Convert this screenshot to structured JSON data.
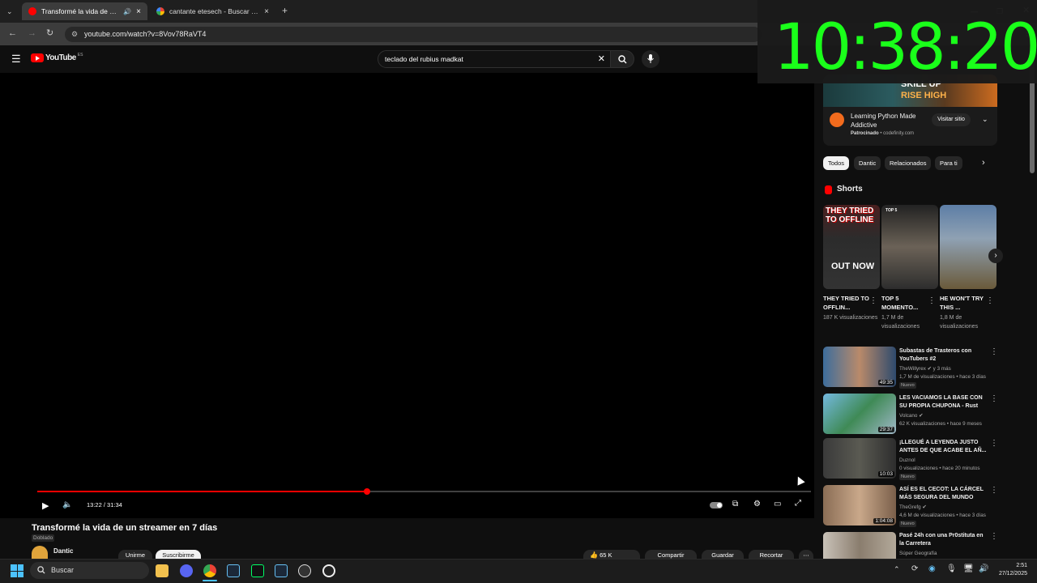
{
  "browser": {
    "tabs": [
      {
        "title": "Transformé la vida de un st",
        "active": true
      },
      {
        "title": "cantante etesech - Buscar con G",
        "active": false
      }
    ],
    "url": "youtube.com/watch?v=8Vov78RaVT4"
  },
  "youtube": {
    "logo": "YouTube",
    "region": "ES",
    "search_value": "teclado del rubius madkat",
    "player": {
      "time": "13:22 / 31:34",
      "progress_fraction": 0.426
    },
    "video": {
      "title": "Transformé la vida de un streamer en 7 días",
      "dub_label": "Doblado",
      "channel": "Dantic",
      "join_label": "Unirme",
      "subscribe_label": "Suscribirme",
      "likes": "65 K",
      "share_label": "Compartir",
      "save_label": "Guardar",
      "clip_label": "Recortar"
    },
    "ad": {
      "headline1": "SKILL UP",
      "headline2": "RISE HIGH",
      "title": "Learning Python Made Addictive",
      "sponsored": "Patrocinado",
      "domain": "codefinity.com",
      "cta": "Visitar sitio"
    },
    "chips": [
      "Todos",
      "Dantic",
      "Relacionados",
      "Para ti"
    ],
    "shorts_heading": "Shorts",
    "shorts": [
      {
        "title": "THEY TRIED TO OFFLIN...",
        "views": "187 K visualizaciones",
        "thumb_text1": "THEY TRIED",
        "thumb_text2": "TO OFFLINE",
        "thumb_text3": "OUT NOW"
      },
      {
        "title": "TOP 5 MOMENTO...",
        "views": "1,7 M de visualizaciones",
        "thumb_text1": "TOP 5"
      },
      {
        "title": "HE WON'T TRY THIS ...",
        "views": "1,8 M de visualizaciones"
      }
    ],
    "videos": [
      {
        "title": "Subastas de Trasteros con YouTubers #2",
        "channel": "TheWillyrex",
        "channel_extra": "y 3 más",
        "meta": "1,7 M de visualizaciones • hace 3 días",
        "duration": "49:35",
        "badge": "Nuevo"
      },
      {
        "title": "LES VACIAMOS LA BASE CON SU PROPIA CHUPONA - Rust",
        "channel": "Volcano",
        "meta": "62 K visualizaciones • hace 9 meses",
        "duration": "29:37",
        "badge": ""
      },
      {
        "title": "¡LLEGUÉ A LEYENDA JUSTO ANTES DE QUE ACABE EL AÑ...",
        "channel": "Duznol",
        "meta": "0 visualizaciones • hace 20 minutos",
        "duration": "10:03",
        "badge": "Nuevo"
      },
      {
        "title": "ASÍ ES EL CECOT: LA CÁRCEL MÁS SEGURA DEL MUNDO",
        "channel": "TheGrefg",
        "meta": "4,6 M de visualizaciones • hace 3 días",
        "duration": "1:04:08",
        "badge": "Nuevo"
      },
      {
        "title": "Pasé 24h con una Pr0stituta en la Carretera",
        "channel": "Súper Geografía",
        "meta": "",
        "duration": "",
        "badge": ""
      }
    ]
  },
  "overlay_clock": "10:38:20",
  "taskbar": {
    "search_label": "Buscar",
    "time": "2:51",
    "date": "27/12/2025"
  },
  "colors": {
    "accent": "#ff0000",
    "clock": "#1aff1a"
  }
}
